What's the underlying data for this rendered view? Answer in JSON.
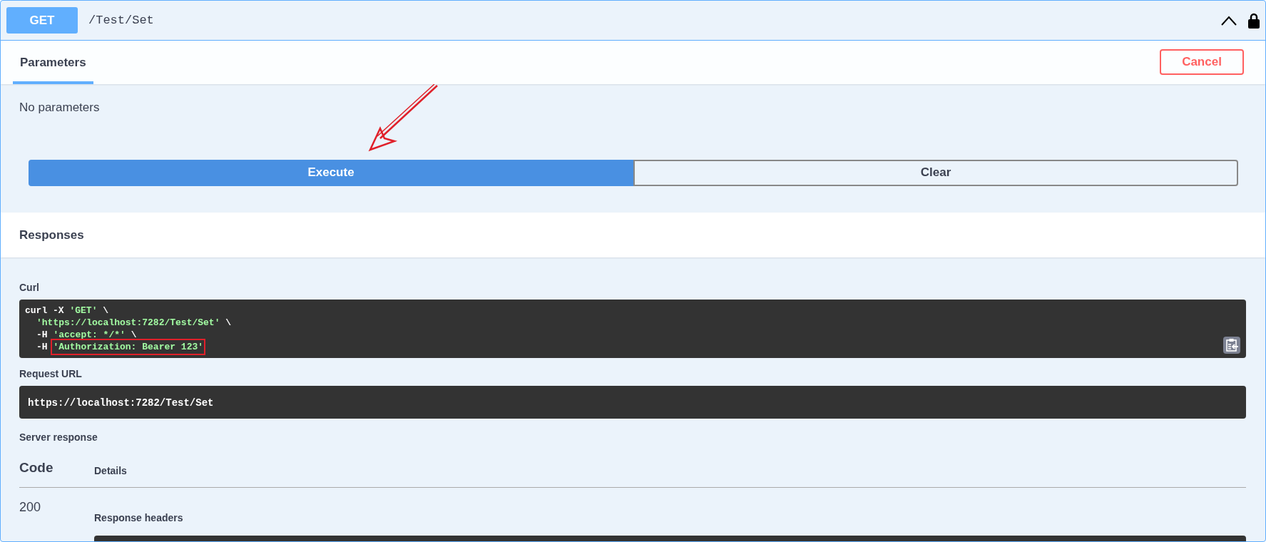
{
  "operation": {
    "method": "GET",
    "path": "/Test/Set",
    "expanded": true,
    "locked": true
  },
  "tabs": [
    {
      "label": "Parameters",
      "selected": true
    }
  ],
  "cancel_button": "Cancel",
  "parameters_text": "No parameters",
  "annotations": [
    {
      "kind": "arrow"
    }
  ],
  "buttons": [
    {
      "label": "Execute",
      "kind": "primary"
    },
    {
      "label": "Clear",
      "kind": "secondary"
    }
  ],
  "responses_title": "Responses",
  "curl": {
    "label": "Curl",
    "lines": [
      {
        "indented": false,
        "tokens": [
          {
            "text": "curl -X ",
            "kind": "plain"
          },
          {
            "text": "'GET'",
            "kind": "string"
          },
          {
            "text": " \\",
            "kind": "plain"
          }
        ]
      },
      {
        "indented": true,
        "tokens": [
          {
            "text": "'https://localhost:7282/Test/Set'",
            "kind": "string"
          },
          {
            "text": " \\",
            "kind": "plain"
          }
        ]
      },
      {
        "indented": true,
        "tokens": [
          {
            "text": "-H ",
            "kind": "plain"
          },
          {
            "text": "'accept: */*'",
            "kind": "string"
          },
          {
            "text": " \\",
            "kind": "plain"
          }
        ]
      },
      {
        "indented": true,
        "tokens": [
          {
            "text": "-H ",
            "kind": "plain"
          },
          {
            "text": "'Authorization: Bearer 123'",
            "kind": "string",
            "highlighted": true
          }
        ]
      }
    ]
  },
  "request_url": {
    "label": "Request URL",
    "value": "https://localhost:7282/Test/Set"
  },
  "server_response": {
    "label": "Server response",
    "columns": [
      "Code",
      "Details"
    ],
    "rows": [
      {
        "code": "200",
        "details_title": "Response headers"
      }
    ]
  }
}
